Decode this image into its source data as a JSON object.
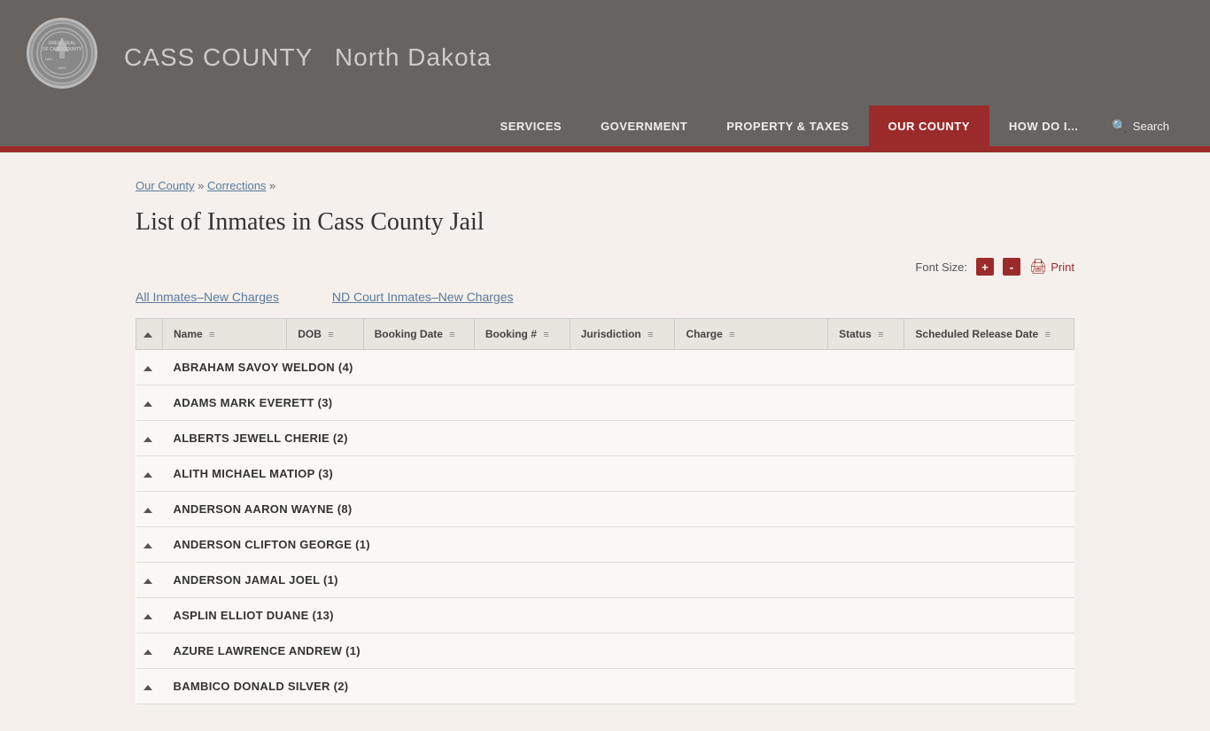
{
  "header": {
    "county_name": "CASS COUNTY",
    "state": "North Dakota",
    "seal_text": "GREAT SEAL OF CASS COUNTY"
  },
  "nav": {
    "items": [
      {
        "label": "SERVICES",
        "active": false
      },
      {
        "label": "GOVERNMENT",
        "active": false
      },
      {
        "label": "PROPERTY & TAXES",
        "active": false
      },
      {
        "label": "OUR COUNTY",
        "active": true
      },
      {
        "label": "HOW DO I...",
        "active": false
      }
    ],
    "search_label": "Search"
  },
  "breadcrumb": {
    "links": [
      {
        "label": "Our County",
        "href": "#"
      },
      {
        "label": "Corrections",
        "href": "#"
      }
    ],
    "separator": "»"
  },
  "page": {
    "title": "List of Inmates in Cass County Jail"
  },
  "toolbar": {
    "font_size_label": "Font Size:",
    "increase_label": "+",
    "decrease_label": "-",
    "print_label": "Print"
  },
  "filter_links": [
    {
      "label": "All Inmates–New Charges"
    },
    {
      "label": "ND Court Inmates–New Charges"
    }
  ],
  "table": {
    "columns": [
      {
        "label": ""
      },
      {
        "label": "Name",
        "sortable": true
      },
      {
        "label": "DOB",
        "sortable": true
      },
      {
        "label": "Booking Date",
        "sortable": true
      },
      {
        "label": "Booking #",
        "sortable": true
      },
      {
        "label": "Jurisdiction",
        "sortable": true
      },
      {
        "label": "Charge",
        "sortable": true
      },
      {
        "label": "Status",
        "sortable": true
      },
      {
        "label": "Scheduled Release Date",
        "sortable": true
      }
    ],
    "rows": [
      {
        "name": "ABRAHAM SAVOY WELDON (4)"
      },
      {
        "name": "ADAMS MARK EVERETT (3)"
      },
      {
        "name": "ALBERTS JEWELL CHERIE (2)"
      },
      {
        "name": "ALITH MICHAEL MATIOP (3)"
      },
      {
        "name": "ANDERSON AARON WAYNE (8)"
      },
      {
        "name": "ANDERSON CLIFTON GEORGE (1)"
      },
      {
        "name": "ANDERSON JAMAL JOEL (1)"
      },
      {
        "name": "ASPLIN ELLIOT DUANE (13)"
      },
      {
        "name": "AZURE LAWRENCE ANDREW (1)"
      },
      {
        "name": "BAMBICO DONALD SILVER (2)"
      }
    ]
  }
}
